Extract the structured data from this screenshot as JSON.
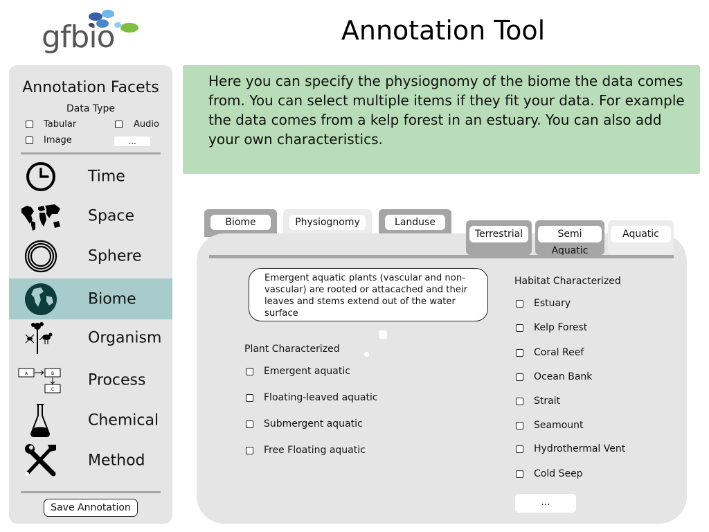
{
  "header": {
    "logo_text": "gfbio",
    "title": "Annotation Tool"
  },
  "sidebar": {
    "title": "Annotation Facets",
    "data_type": {
      "label": "Data Type",
      "options": [
        "Tabular",
        "Audio",
        "Image"
      ],
      "more_label": "..."
    },
    "facets": [
      {
        "label": "Time",
        "icon": "clock-icon",
        "active": false
      },
      {
        "label": "Space",
        "icon": "world-map-icon",
        "active": false
      },
      {
        "label": "Sphere",
        "icon": "sphere-rings-icon",
        "active": false
      },
      {
        "label": "Biome",
        "icon": "globe-icon",
        "active": true
      },
      {
        "label": "Organism",
        "icon": "organism-icon",
        "active": false
      },
      {
        "label": "Process",
        "icon": "process-flow-icon",
        "active": false
      },
      {
        "label": "Chemical",
        "icon": "flask-icon",
        "active": false
      },
      {
        "label": "Method",
        "icon": "tools-icon",
        "active": false
      }
    ],
    "save_label": "Save Annotation"
  },
  "info": {
    "text": "Here you can specify the physiognomy of the biome the data comes from. You can select multiple items if they fit your data. For example the data comes from a kelp forest in an estuary. You can also add your own characteristics."
  },
  "tabs": {
    "primary": [
      {
        "label": "Biome",
        "active": false
      },
      {
        "label": "Physiognomy",
        "active": true
      },
      {
        "label": "Landuse",
        "active": false
      }
    ],
    "secondary": [
      {
        "label": "Terrestrial",
        "active": false
      },
      {
        "label": "Semi Aquatic",
        "active": false
      },
      {
        "label": "Aquatic",
        "active": true
      }
    ]
  },
  "tooltip": {
    "text": "Emergent aquatic plants (vascular and non-vascular) are rooted or attacached and their leaves and stems extend out of the water surface"
  },
  "plant": {
    "title": "Plant Characterized",
    "items": [
      "Emergent aquatic",
      "Floating-leaved aquatic",
      "Submergent aquatic",
      "Free Floating aquatic"
    ]
  },
  "habitat": {
    "title": "Habitat Characterized",
    "items": [
      "Estuary",
      "Kelp Forest",
      "Coral Reef",
      "Ocean Bank",
      "Strait",
      "Seamount",
      "Hydrothermal Vent",
      "Cold Seep"
    ],
    "more_label": "..."
  },
  "colors": {
    "active_facet": "#a8cbcb",
    "info_box": "#b8ddb8",
    "panel": "#e5e5e5",
    "tab_inactive": "#a5a5a5"
  }
}
